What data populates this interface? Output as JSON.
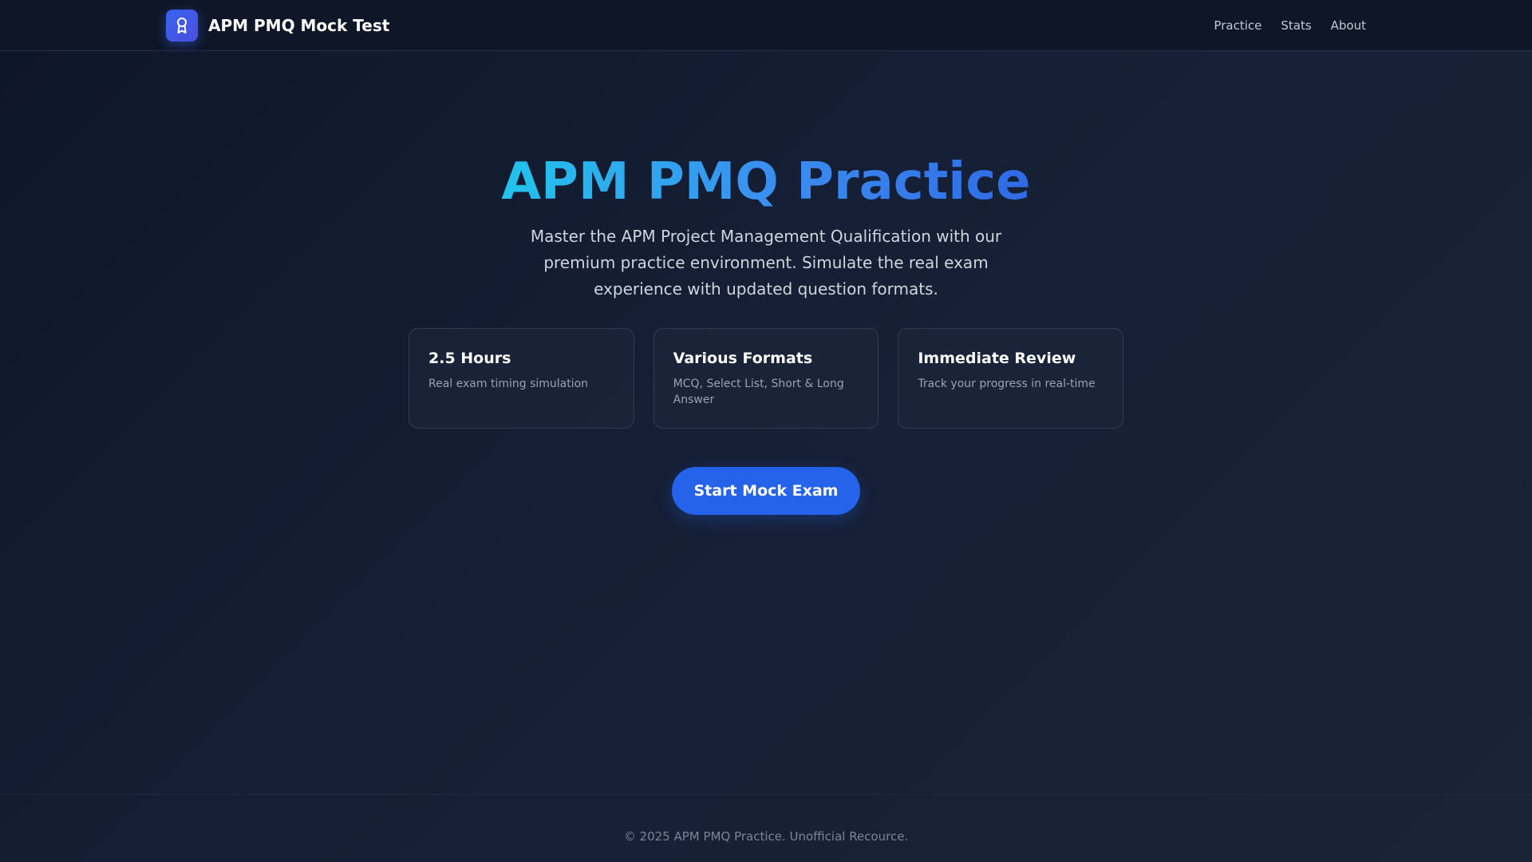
{
  "header": {
    "brand_title": "APM PMQ Mock Test",
    "logo_icon": "award-ribbon-icon",
    "nav": [
      {
        "label": "Practice"
      },
      {
        "label": "Stats"
      },
      {
        "label": "About"
      }
    ]
  },
  "hero": {
    "title": "APM PMQ Practice",
    "subtitle": "Master the APM Project Management Qualification with our premium practice environment. Simulate the real exam experience with updated question formats."
  },
  "features": [
    {
      "title": "2.5 Hours",
      "description": "Real exam timing simulation"
    },
    {
      "title": "Various Formats",
      "description": "MCQ, Select List, Short & Long Answer"
    },
    {
      "title": "Immediate Review",
      "description": "Track your progress in real-time"
    }
  ],
  "cta": {
    "label": "Start Mock Exam"
  },
  "footer": {
    "text": "© 2025 APM PMQ Practice. Unofficial Recource."
  },
  "colors": {
    "accent": "#2563eb",
    "background": "#0e1628",
    "title_gradient_start": "#22c3ec",
    "title_gradient_end": "#2f6ae6"
  }
}
